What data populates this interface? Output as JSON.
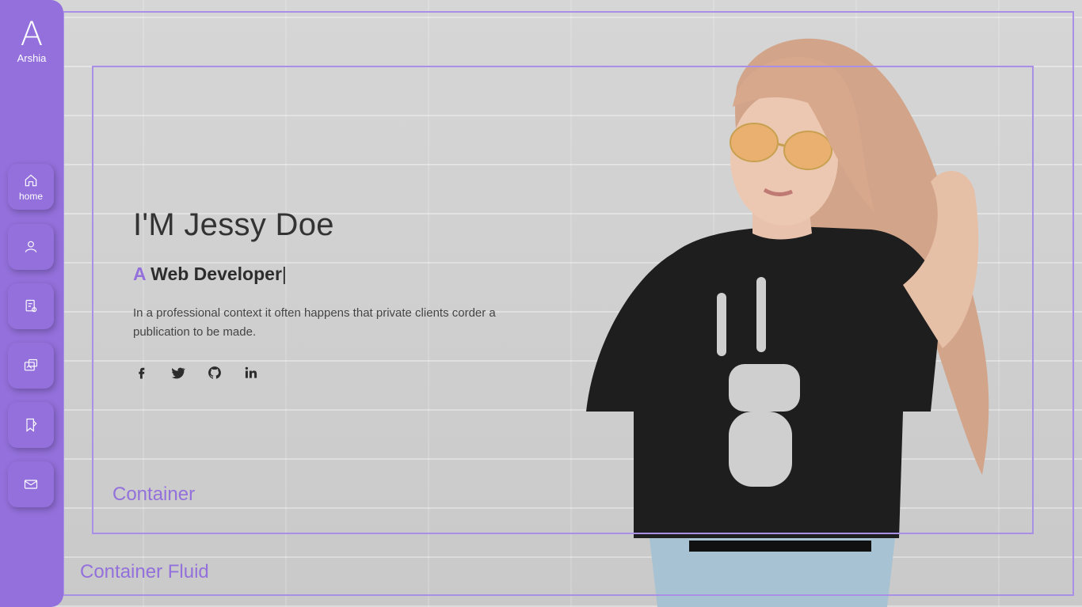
{
  "logo": {
    "letter": "A",
    "name": "Arshia"
  },
  "nav": [
    {
      "label": "home",
      "icon": "home-icon"
    },
    {
      "label": "",
      "icon": "user-icon"
    },
    {
      "label": "",
      "icon": "resume-icon"
    },
    {
      "label": "",
      "icon": "portfolio-icon"
    },
    {
      "label": "",
      "icon": "blog-icon"
    },
    {
      "label": "",
      "icon": "mail-icon"
    }
  ],
  "hero": {
    "title": "I'M Jessy Doe",
    "role_prefix": "A",
    "role": "Web Developer",
    "cursor": "|",
    "description": "In a professional context it often happens that private clients corder a publication to be made."
  },
  "social": [
    "facebook-icon",
    "twitter-icon",
    "github-icon",
    "linkedin-icon"
  ],
  "guides": {
    "container": "Container",
    "container_fluid": "Container Fluid"
  },
  "colors": {
    "accent": "#9370db",
    "text": "#2d2d2d",
    "background": "#cfcfcf"
  }
}
